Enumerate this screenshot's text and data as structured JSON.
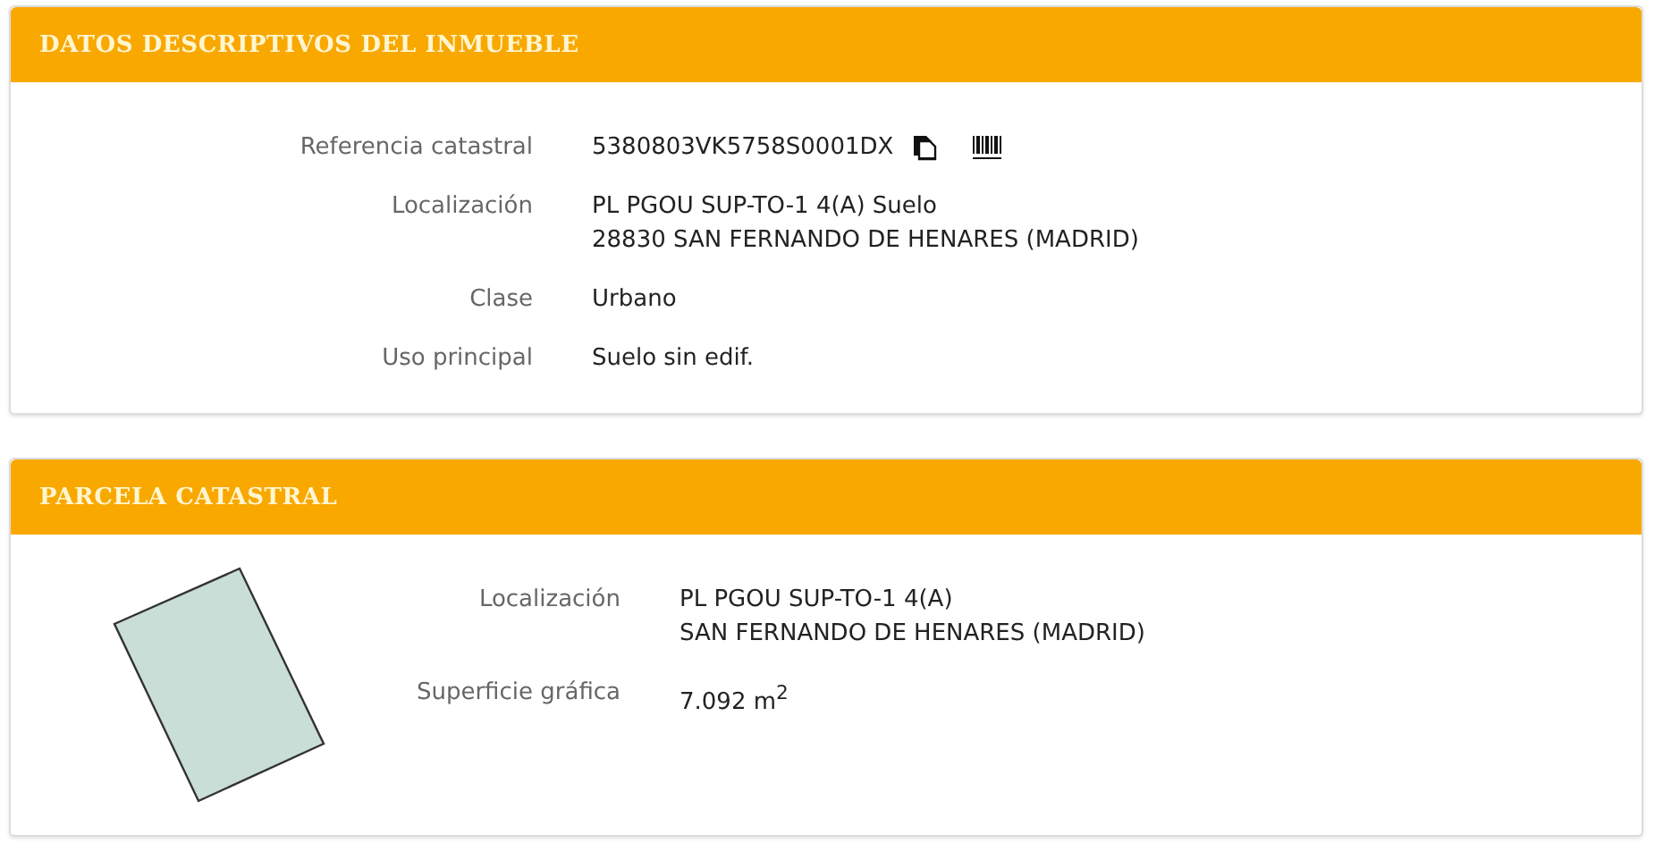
{
  "sections": [
    {
      "kind": "plain",
      "title": "DATOS DESCRIPTIVOS DEL INMUEBLE",
      "rows": [
        {
          "label": "Referencia catastral",
          "lines": [
            "5380803VK5758S0001DX"
          ],
          "tools": true
        },
        {
          "label": "Localización",
          "lines": [
            "PL PGOU SUP-TO-1 4(A) Suelo",
            "28830 SAN FERNANDO DE HENARES (MADRID)"
          ]
        },
        {
          "label": "Clase",
          "lines": [
            "Urbano"
          ]
        },
        {
          "label": "Uso principal",
          "lines": [
            "Suelo sin edif."
          ]
        }
      ]
    },
    {
      "kind": "parcel",
      "title": "PARCELA CATASTRAL",
      "rows": [
        {
          "label": "Localización",
          "lines": [
            "PL PGOU SUP-TO-1 4(A)",
            "SAN FERNANDO DE HENARES (MADRID)"
          ]
        },
        {
          "label": "Superficie gráfica",
          "lines": [
            "7.092 m$^{2}$"
          ]
        }
      ]
    }
  ]
}
